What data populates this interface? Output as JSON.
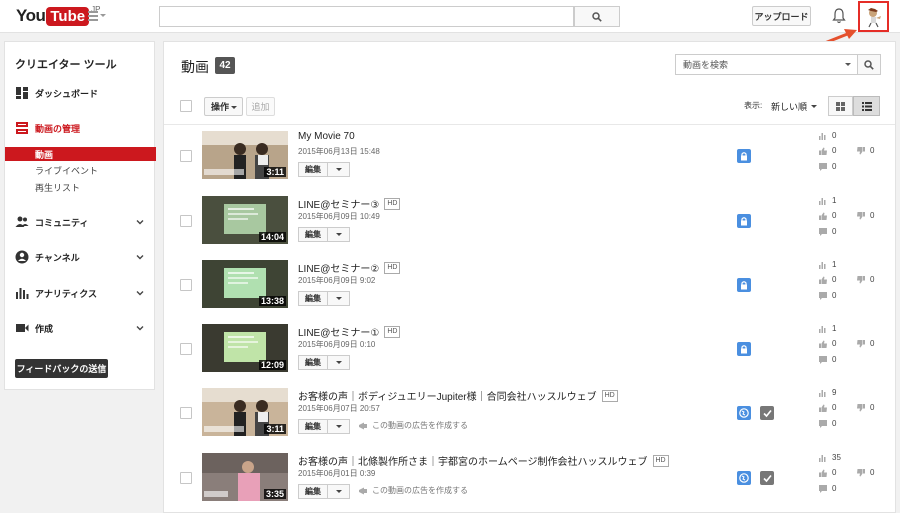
{
  "topbar": {
    "logo_you": "You",
    "logo_tube": "Tube",
    "logo_region": "JP",
    "search_placeholder": "",
    "upload_label": "アップロード"
  },
  "sidebar": {
    "title": "クリエイター ツール",
    "items": [
      {
        "label": "ダッシュボード",
        "icon": "dashboard-icon"
      },
      {
        "label": "動画の管理",
        "icon": "video-manager-icon",
        "active": true
      },
      {
        "label": "コミュニティ",
        "icon": "community-icon"
      },
      {
        "label": "チャンネル",
        "icon": "channel-icon"
      },
      {
        "label": "アナリティクス",
        "icon": "analytics-icon"
      },
      {
        "label": "作成",
        "icon": "create-icon"
      }
    ],
    "subitems": [
      "動画",
      "ライブイベント",
      "再生リスト"
    ],
    "feedback_label": "フィードバックの送信"
  },
  "main": {
    "title": "動画",
    "count": "42",
    "search_placeholder": "動画を検索",
    "action_label": "操作",
    "add_label": "追加",
    "view_label": "表示:",
    "sort_label": "新しい順",
    "edit_label": "編集",
    "ad_label": "この動画の広告を作成する"
  },
  "videos": [
    {
      "title": "My Movie 70",
      "hd": false,
      "date": "2015年06月13日 15:48",
      "duration": "3:11",
      "public": false,
      "ad": false,
      "views": "0",
      "likes": "0",
      "dislikes": "0",
      "comments": "0"
    },
    {
      "title": "LINE@セミナー③",
      "hd": true,
      "date": "2015年06月09日 10:49",
      "duration": "14:04",
      "public": false,
      "ad": false,
      "views": "1",
      "likes": "0",
      "dislikes": "0",
      "comments": "0"
    },
    {
      "title": "LINE@セミナー②",
      "hd": true,
      "date": "2015年06月09日 9:02",
      "duration": "13:38",
      "public": false,
      "ad": false,
      "views": "1",
      "likes": "0",
      "dislikes": "0",
      "comments": "0"
    },
    {
      "title": "LINE@セミナー①",
      "hd": true,
      "date": "2015年06月09日 0:10",
      "duration": "12:09",
      "public": false,
      "ad": false,
      "views": "1",
      "likes": "0",
      "dislikes": "0",
      "comments": "0"
    },
    {
      "title": "お客様の声｜ボディジュエリーJupiter様｜合同会社ハッスルウェブ",
      "hd": true,
      "date": "2015年06月07日 20:57",
      "duration": "3:11",
      "public": true,
      "ad": true,
      "views": "9",
      "likes": "0",
      "dislikes": "0",
      "comments": "0"
    },
    {
      "title": "お客様の声｜北條製作所さま｜宇都宮のホームページ制作会社ハッスルウェブ",
      "hd": true,
      "date": "2015年06月01日 0:39",
      "duration": "3:35",
      "public": true,
      "ad": true,
      "views": "35",
      "likes": "0",
      "dislikes": "0",
      "comments": "0"
    }
  ],
  "hd_label": "HD"
}
